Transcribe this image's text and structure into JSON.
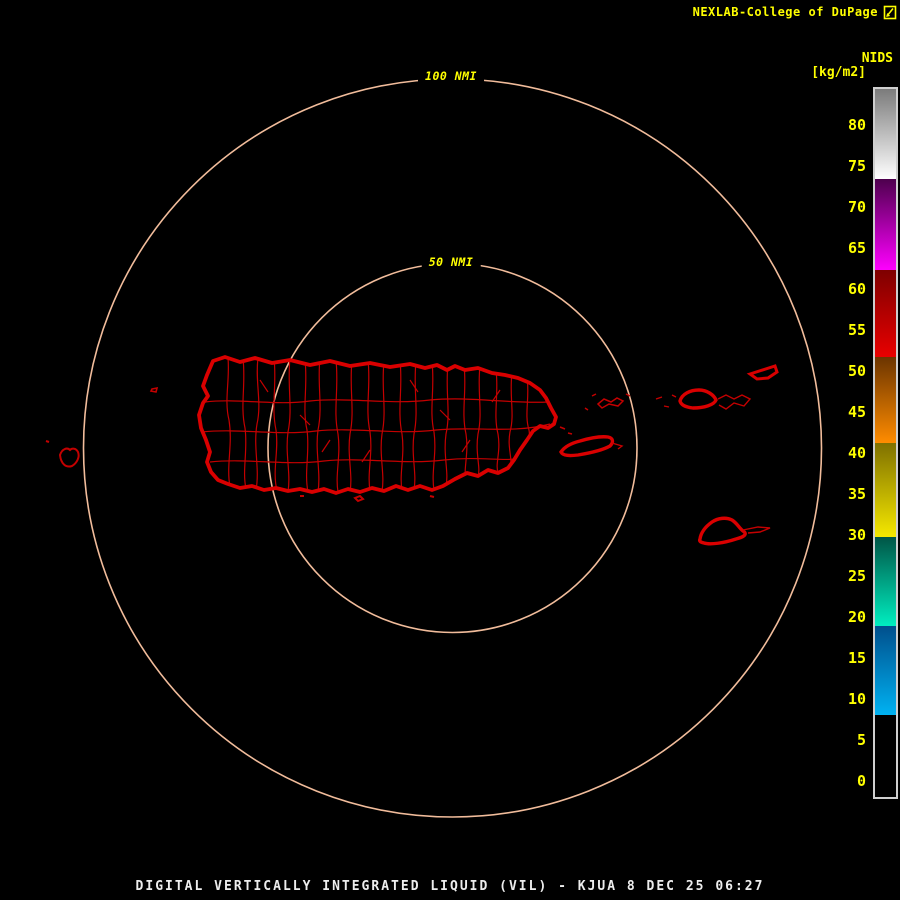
{
  "header": {
    "credit_text": "NEXLAB-College of DuPage",
    "logo_icon": "dupage-logo-icon"
  },
  "colorbar": {
    "title": "NIDS",
    "units": "[kg/m2]",
    "ticks": [
      80,
      75,
      70,
      65,
      60,
      55,
      50,
      45,
      40,
      35,
      30,
      25,
      20,
      15,
      10,
      5,
      0
    ],
    "segments": [
      {
        "name": "gray",
        "v_hi": 84.4,
        "v_lo": 73.4,
        "color_top": "#7b7b7b",
        "color_bottom": "#ffffff"
      },
      {
        "name": "magenta",
        "v_hi": 73.4,
        "v_lo": 62.3,
        "color_top": "#4d004d",
        "color_bottom": "#ff00ff"
      },
      {
        "name": "red",
        "v_hi": 62.3,
        "v_lo": 51.7,
        "color_top": "#7e0000",
        "color_bottom": "#e80000"
      },
      {
        "name": "orange",
        "v_hi": 51.7,
        "v_lo": 41.2,
        "color_top": "#6b3400",
        "color_bottom": "#ff8c00"
      },
      {
        "name": "yellow",
        "v_hi": 41.2,
        "v_lo": 29.8,
        "color_top": "#7f7000",
        "color_bottom": "#f5e800"
      },
      {
        "name": "teal",
        "v_hi": 29.8,
        "v_lo": 18.9,
        "color_top": "#005546",
        "color_bottom": "#00eec0"
      },
      {
        "name": "blue",
        "v_hi": 18.9,
        "v_lo": 8.0,
        "color_top": "#004f8c",
        "color_bottom": "#00b2f2"
      },
      {
        "name": "black",
        "v_hi": 8.0,
        "v_lo": -2.0,
        "color_top": "#000000",
        "color_bottom": "#000000"
      }
    ]
  },
  "rings": {
    "outer_label": "100 NMI",
    "inner_label": "50 NMI",
    "ring_color": "#f1bc9b"
  },
  "map": {
    "outline_color": "#d90000",
    "boundary_color": "#c40000",
    "regions": [
      "puerto-rico",
      "vieques",
      "culebra",
      "st-thomas",
      "st-john",
      "tortola",
      "st-croix",
      "mona",
      "desecheo"
    ]
  },
  "footer": {
    "title": "DIGITAL VERTICALLY INTEGRATED LIQUID (VIL) - KJUA 8 DEC 25 06:27"
  },
  "colors": {
    "accent_yellow": "#ffff00",
    "ring_color": "#f1bc9b",
    "map_red": "#d90000",
    "title_white": "#ededed"
  }
}
